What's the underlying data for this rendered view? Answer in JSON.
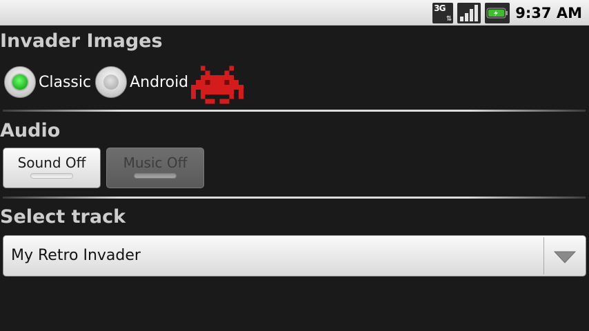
{
  "status_bar": {
    "network": "3G",
    "time": "9:37 AM"
  },
  "invader_images": {
    "title": "Invader Images",
    "options": [
      {
        "label": "Classic",
        "selected": true
      },
      {
        "label": "Android",
        "selected": false
      }
    ],
    "preview_color": "#d41c1c"
  },
  "audio": {
    "title": "Audio",
    "sound_button": {
      "label": "Sound Off",
      "enabled": true
    },
    "music_button": {
      "label": "Music Off",
      "enabled": false
    }
  },
  "select_track": {
    "title": "Select track",
    "selected": "My Retro Invader"
  },
  "colors": {
    "background": "#1a1a1a",
    "radio_selected": "#1fb41f",
    "heading": "#cdcdcd"
  }
}
